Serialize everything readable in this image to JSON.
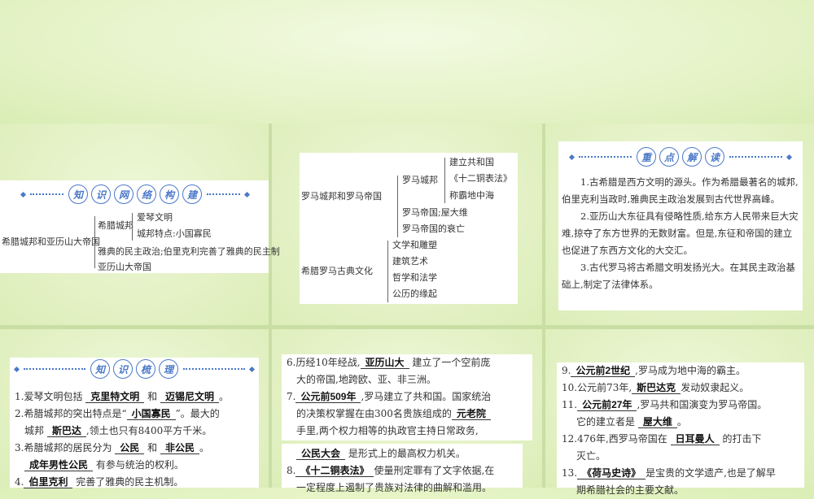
{
  "panel1": {
    "heading_chars": [
      "知",
      "识",
      "网",
      "络",
      "构",
      "建"
    ],
    "root": "希腊城邦和亚历山大帝国",
    "items": [
      "希腊城邦",
      "爱琴文明",
      "城邦特点:小国寡民",
      "雅典的民主政治;伯里克利完善了雅典的民主制",
      "亚历山大帝国"
    ]
  },
  "panel2": {
    "root1": "罗马城邦和罗马帝国",
    "sub1": "罗马城邦",
    "sub1_items": [
      "建立共和国",
      "《十二铜表法》",
      "称霸地中海"
    ],
    "sub2": "罗马帝国;屋大维",
    "sub3": "罗马帝国的衰亡",
    "root2": "希腊罗马古典文化",
    "root2_items": [
      "文学和雕塑",
      "建筑艺术",
      "哲学和法学",
      "公历的缘起"
    ]
  },
  "panel3": {
    "heading_chars": [
      "重",
      "点",
      "解",
      "读"
    ],
    "paragraphs": [
      "1.古希腊是西方文明的源头。作为希腊最著名的城邦,伯里克利当政时,雅典民主政治发展到古代世界高峰。",
      "2.亚历山大东征具有侵略性质,给东方人民带来巨大灾难,掠夺了东方世界的无数财富。但是,东征和帝国的建立也促进了东西方文化的大交汇。",
      "3.古代罗马将古希腊文明发扬光大。在其民主政治基础上,制定了法律体系。"
    ]
  },
  "panel4": {
    "heading_chars": [
      "知",
      "识",
      "梳",
      "理"
    ],
    "l1_pre": "1.爱琴文明包括",
    "l1_a": "克里特文明",
    "l1_mid": "和",
    "l1_b": "迈锡尼文明",
    "l1_post": "。",
    "l2_pre": "2.希腊城邦的突出特点是“",
    "l2_a": "小国寡民",
    "l2_post": "”。最大的",
    "l2b_pre": "城邦",
    "l2b_a": "斯巴达",
    "l2b_post": ",领土也只有8400平方千米。",
    "l3_pre": "3.希腊城邦的居民分为",
    "l3_a": "公民",
    "l3_mid": "和",
    "l3_b": "非公民",
    "l3_post": "。",
    "l3b_a": "成年男性公民",
    "l3b_post": "有参与统治的权利。",
    "l4_pre": "4.",
    "l4_a": "伯里克利",
    "l4_post": "完善了雅典的民主机制。"
  },
  "panel5": {
    "l6_pre": "6.历经10年经战,",
    "l6_a": "亚历山大",
    "l6_post": "建立了一个空前庞",
    "l6b": "大的帝国,地跨欧、亚、非三洲。",
    "l7_pre": "7.",
    "l7_a": "公元前509年",
    "l7_post": ",罗马建立了共和国。国家统治",
    "l7b_pre": "的决策权掌握在由300名贵族组成的",
    "l7b_a": "元老院",
    "l7c": "手里,两个权力相等的执政官主持日常政务,",
    "l7d_a": "公民大会",
    "l7d_post": "是形式上的最高权力机关。",
    "l8_pre": "8.",
    "l8_a": "《十二铜表法》",
    "l8_post": "使量刑定罪有了文字依据,在",
    "l8b": "一定程度上遏制了贵族对法律的曲解和滥用。"
  },
  "panel6": {
    "l9_pre": "9.",
    "l9_a": "公元前2世纪",
    "l9_post": ",罗马成为地中海的霸主。",
    "l10_pre": "10.公元前73年,",
    "l10_a": "斯巴达克",
    "l10_post": "发动奴隶起义。",
    "l11_pre": "11.",
    "l11_a": "公元前27年",
    "l11_post": ",罗马共和国演变为罗马帝国。",
    "l11b_pre": "它的建立者是",
    "l11b_a": "屋大维",
    "l11b_post": "。",
    "l12_pre": "12.476年,西罗马帝国在",
    "l12_a": "日耳曼人",
    "l12_post": "的打击下",
    "l12b": "灭亡。",
    "l13_pre": "13.",
    "l13_a": "《荷马史诗》",
    "l13_post": "是宝贵的文学遗产,也是了解早",
    "l13b": "期希腊社会的主要文献。"
  }
}
